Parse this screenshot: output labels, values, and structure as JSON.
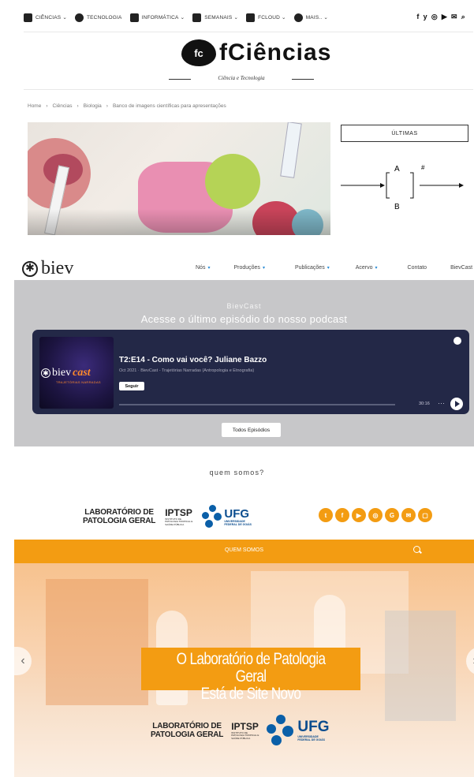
{
  "fciencias": {
    "nav": [
      {
        "label": "CIÊNCIAS",
        "caret": "⌄",
        "icon": "flask-icon"
      },
      {
        "label": "TECNOLOGIA",
        "caret": "",
        "icon": "robot-icon"
      },
      {
        "label": "INFORMÁTICA",
        "caret": "⌄",
        "icon": "laptop-icon"
      },
      {
        "label": "SEMANAIS",
        "caret": "⌄",
        "icon": "calendar-icon"
      },
      {
        "label": "FCLOUD",
        "caret": "⌄",
        "icon": "cloud-icon"
      },
      {
        "label": "MAIS..",
        "caret": "⌄",
        "icon": "plus-circle-icon"
      }
    ],
    "social_icons": [
      "facebook-icon",
      "twitter-icon",
      "instagram-icon",
      "youtube-icon",
      "mail-icon",
      "search-icon"
    ],
    "logo_mark": "fc",
    "logo_name": "fCiências",
    "tagline": "Ciência e Tecnologia",
    "breadcrumb": [
      "Home",
      "›",
      "Ciências",
      "›",
      "Biologia",
      "›",
      "Banco de imagens científicas para apresentações"
    ],
    "sidebar_box": "ÚLTIMAS",
    "diagram": {
      "top": "A",
      "bottom": "B",
      "sup": "#"
    }
  },
  "biev": {
    "logo": "biev",
    "menu": [
      {
        "label": "Nós",
        "caret": true
      },
      {
        "label": "Produções",
        "caret": true
      },
      {
        "label": "Publicações",
        "caret": true
      },
      {
        "label": "Acervo",
        "caret": true
      },
      {
        "label": "Contato",
        "caret": false
      },
      {
        "label": "BievCast",
        "caret": false
      }
    ],
    "kicker": "BievCast",
    "title": "Acesse o último episódio do nosso podcast",
    "player": {
      "cover_brand_a": "biev",
      "cover_brand_b": "cast",
      "cover_sub": "TRAJETÓRIAS NARRADAS",
      "episode": "T2:E14 - Como vai você? Juliane Bazzo",
      "meta": "Oct 2021 · BievCast - Trajetórias Narradas (Antropologia e Etnografia)",
      "follow": "Seguir",
      "time": "30:16",
      "more": "···"
    },
    "all_episodes": "Todos Episódios"
  },
  "lpg": {
    "section_title": "quem somos?",
    "lab_line1": "LABORATÓRIO DE",
    "lab_line2": "PATOLOGIA GERAL",
    "iptsp": "IPTSP",
    "iptsp_sub": [
      "INSTITUTO DE",
      "PATOLOGIA TROPICAL E",
      "SAÚDE PÚBLICA"
    ],
    "ufg": "UFG",
    "ufg_sub": [
      "UNIVERSIDADE",
      "FEDERAL DE GOIÁS"
    ],
    "social": [
      "t",
      "f",
      "▶",
      "◎",
      "G",
      "✉",
      "▢"
    ],
    "bar_label": "QUEM SOMOS",
    "banner_line1": "O Laboratório de Patologia Geral",
    "banner_line2": "Está de Site Novo",
    "arrow_left": "‹",
    "arrow_right": "›"
  },
  "colors": {
    "orange": "#f39c12",
    "player_bg": "#232847",
    "biev_gray": "#c7c7c9",
    "ufg_blue": "#0a5fa8"
  }
}
